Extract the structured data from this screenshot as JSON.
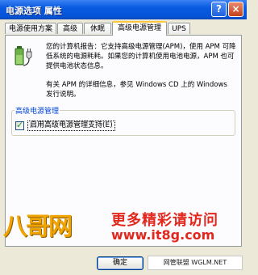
{
  "window": {
    "title": "电源选项 属性",
    "help_glyph": "?",
    "close_glyph": "×"
  },
  "tabs": [
    {
      "label": "电源使用方案",
      "active": false
    },
    {
      "label": "高级",
      "active": false
    },
    {
      "label": "休眠",
      "active": false
    },
    {
      "label": "高级电源管理",
      "active": true
    },
    {
      "label": "UPS",
      "active": false
    }
  ],
  "apm": {
    "icon": "battery-plug-icon",
    "info_text": "您的计算机报告：它支持高级电源管理(APM)，使用 APM 可降低系统的电源耗耗。如果您的计算机使用电池电源，APM 也可提供电池状态信息。",
    "more_info_text": "有关 APM 的详细信息，参见 Windows CD 上的 Windows 发行说明。",
    "group_label": "高级电源管理",
    "checkbox_label": "启用高级电源管理支持(E)",
    "checkbox_checked": true
  },
  "watermark": {
    "logo": "八哥网",
    "line1": "更多精彩请访问",
    "line2": "www.it8g.com",
    "footer": "网管联盟 WGLM.NET"
  },
  "buttons": {
    "ok_label": "确定"
  },
  "colors": {
    "titlebar": "#0a5ae0",
    "active_tab_accent": "#ffc83c",
    "group_label": "#0046d5",
    "watermark_red": "#e2271d",
    "watermark_gold": "#f1a400"
  }
}
